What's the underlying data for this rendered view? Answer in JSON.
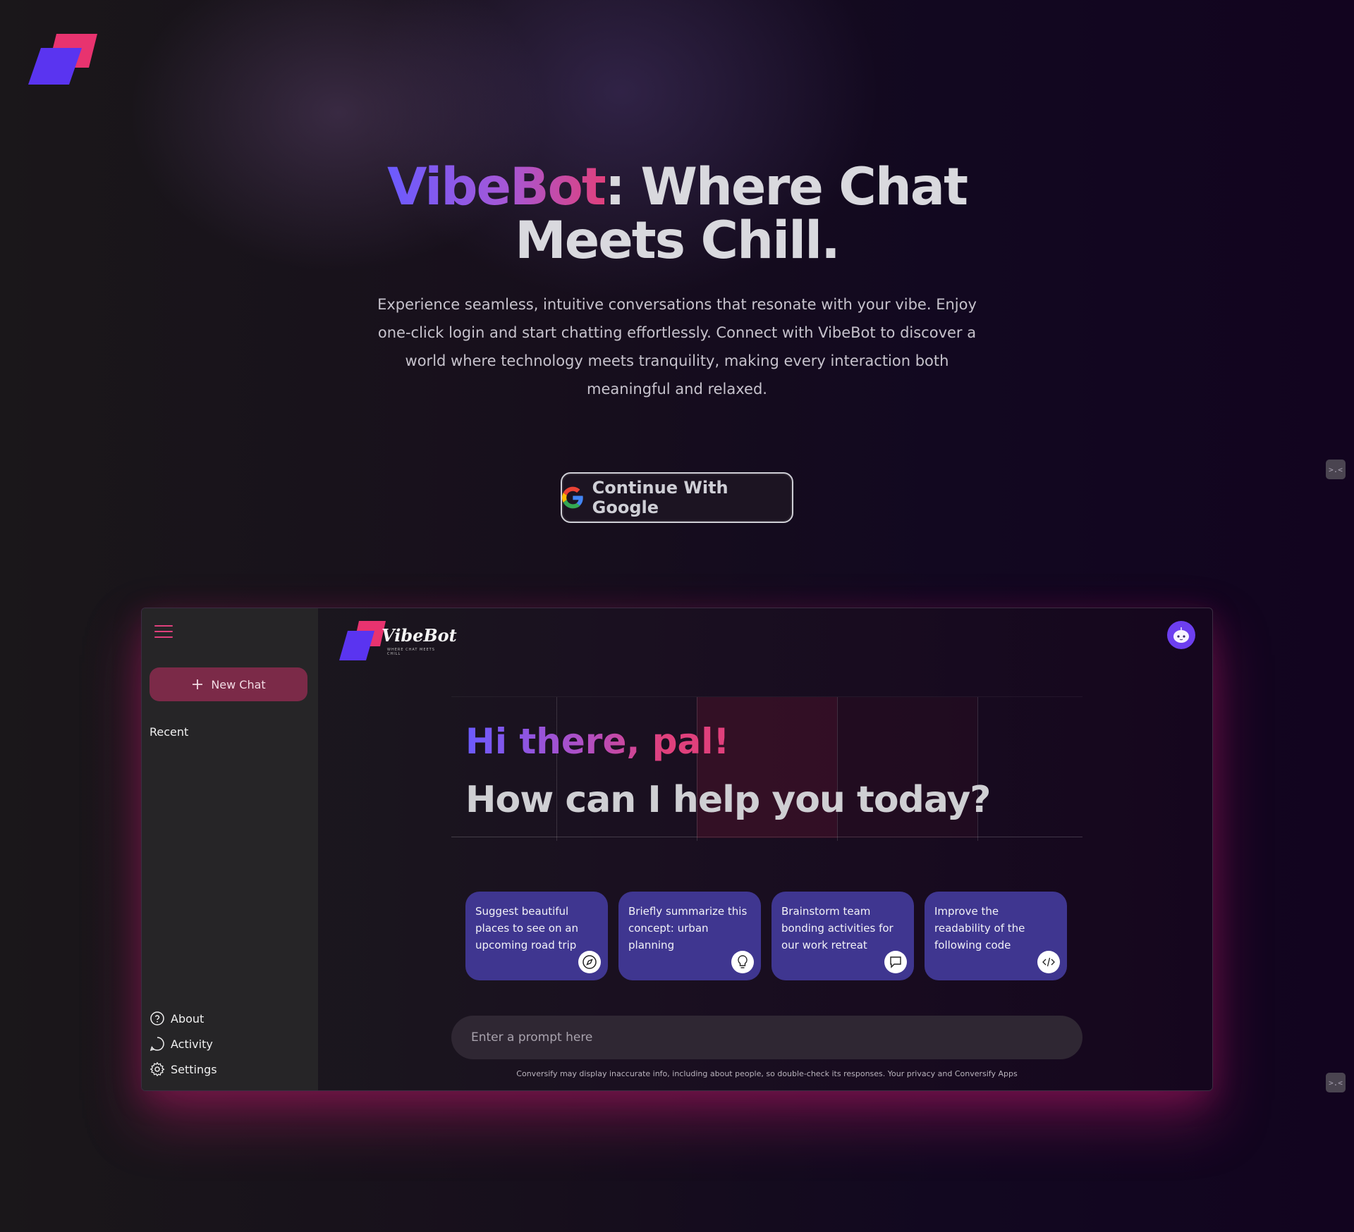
{
  "hero": {
    "title_brand": "VibeBot",
    "title_rest_line1": ": Where Chat",
    "title_line2": "Meets Chill.",
    "subtitle": "Experience seamless, intuitive conversations that resonate with your vibe. Enjoy one-click login and start chatting effortlessly. Connect with VibeBot to discover a world where technology meets tranquility, making every interaction both meaningful and relaxed.",
    "google_button": "Continue With Google"
  },
  "app": {
    "sidebar": {
      "new_chat": "New Chat",
      "recent": "Recent",
      "links": [
        {
          "label": "About",
          "icon": "help-circle-icon"
        },
        {
          "label": "Activity",
          "icon": "activity-icon"
        },
        {
          "label": "Settings",
          "icon": "gear-icon"
        }
      ]
    },
    "logo": {
      "wordmark": "VibeBot",
      "tagline": "WHERE CHAT MEETS CHILL"
    },
    "greeting": {
      "hi": "Hi there, pal!",
      "question": "How can I help you today?"
    },
    "cards": [
      {
        "text": "Suggest beautiful places to see on an upcoming road trip",
        "icon": "compass-icon"
      },
      {
        "text": "Briefly summarize this concept: urban planning",
        "icon": "lightbulb-icon"
      },
      {
        "text": "Brainstorm team bonding activities for our work retreat",
        "icon": "message-icon"
      },
      {
        "text": "Improve the readability of the following code",
        "icon": "code-icon"
      }
    ],
    "prompt_placeholder": "Enter a prompt here",
    "disclaimer": "Conversify may display inaccurate info, including about people, so double-check its responses. Your privacy and Conversify Apps"
  },
  "colors": {
    "accent_pink": "#e0407c",
    "accent_purple": "#6b5bff",
    "card_bg": "#3f3690",
    "new_chat_bg": "#7b2a48"
  }
}
